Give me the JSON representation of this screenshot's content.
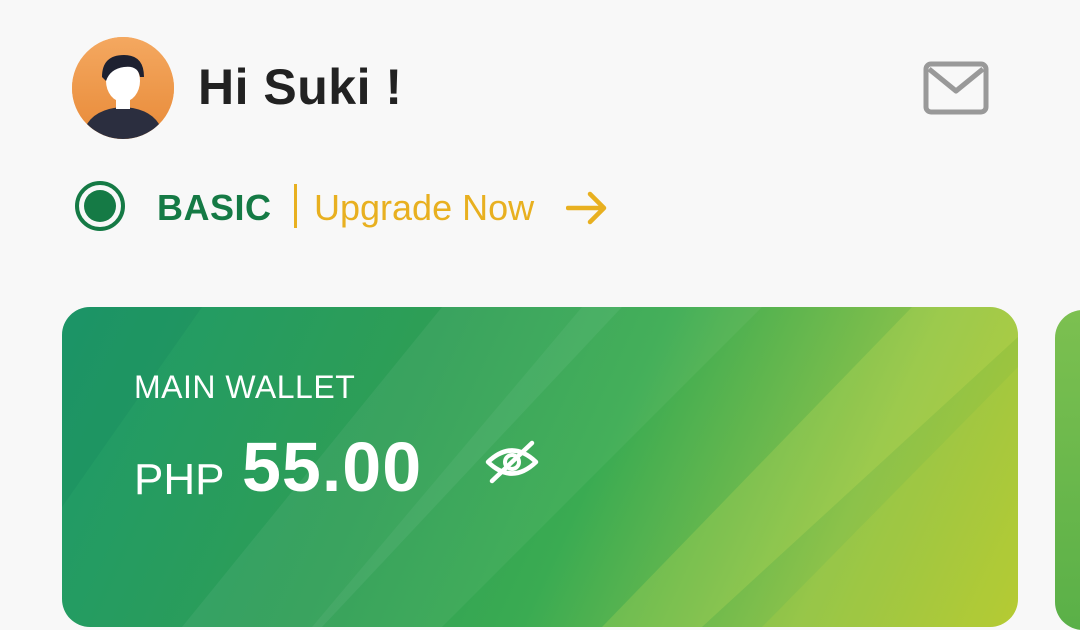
{
  "header": {
    "greeting": "Hi Suki !"
  },
  "tier": {
    "level": "BASIC",
    "upgrade_label": "Upgrade Now"
  },
  "wallet": {
    "label": "MAIN WALLET",
    "currency": "PHP",
    "amount": "55.00"
  },
  "icons": {
    "mail": "mail-icon",
    "tier": "radio-dot-icon",
    "upgrade": "arrow-right-icon",
    "visibility": "eye-off-icon"
  },
  "colors": {
    "background": "#f8f8f8",
    "brand_green": "#157a45",
    "accent_yellow": "#e8b020",
    "greeting_text": "#222222",
    "mail_icon": "#999999",
    "card_gradient_start": "#1e9a6a",
    "card_gradient_end": "#b0c830"
  }
}
